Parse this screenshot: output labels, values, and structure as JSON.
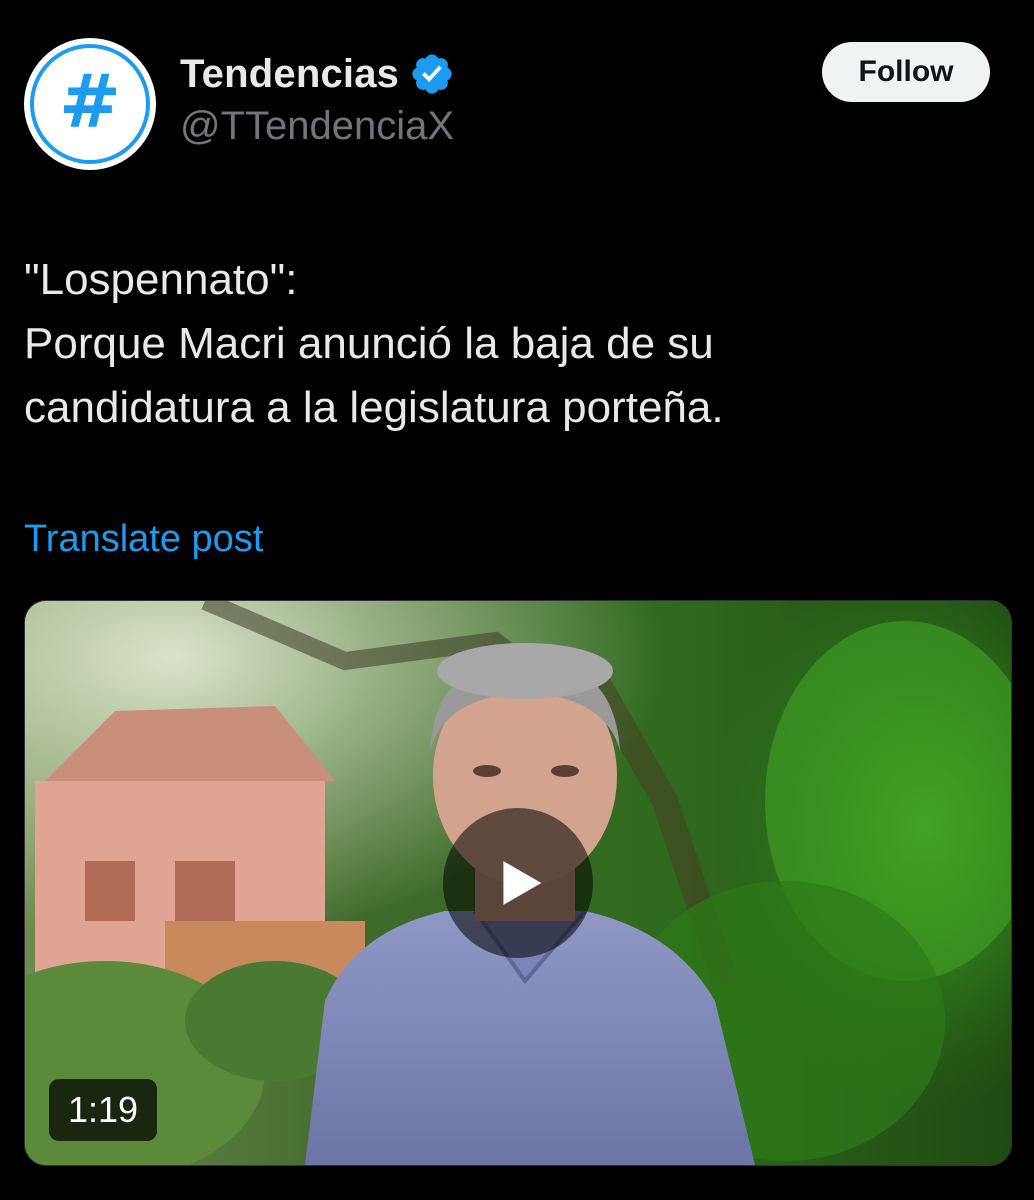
{
  "author": {
    "display_name": "Tendencias",
    "handle": "@TTendenciaX",
    "avatar_glyph": "#",
    "verified_icon": "verified-badge-icon"
  },
  "follow_button": {
    "label": "Follow"
  },
  "post": {
    "lines": [
      "\"Lospennato\":",
      "Porque Macri anunció la baja de su",
      "candidatura a la legislatura porteña."
    ],
    "translate_label": "Translate post"
  },
  "video": {
    "duration": "1:19",
    "play_icon": "play-icon"
  },
  "colors": {
    "background": "#000000",
    "text_primary": "#e7e9ea",
    "text_secondary": "#71767b",
    "accent": "#1d9bf0",
    "button_bg": "#eff3f4"
  }
}
